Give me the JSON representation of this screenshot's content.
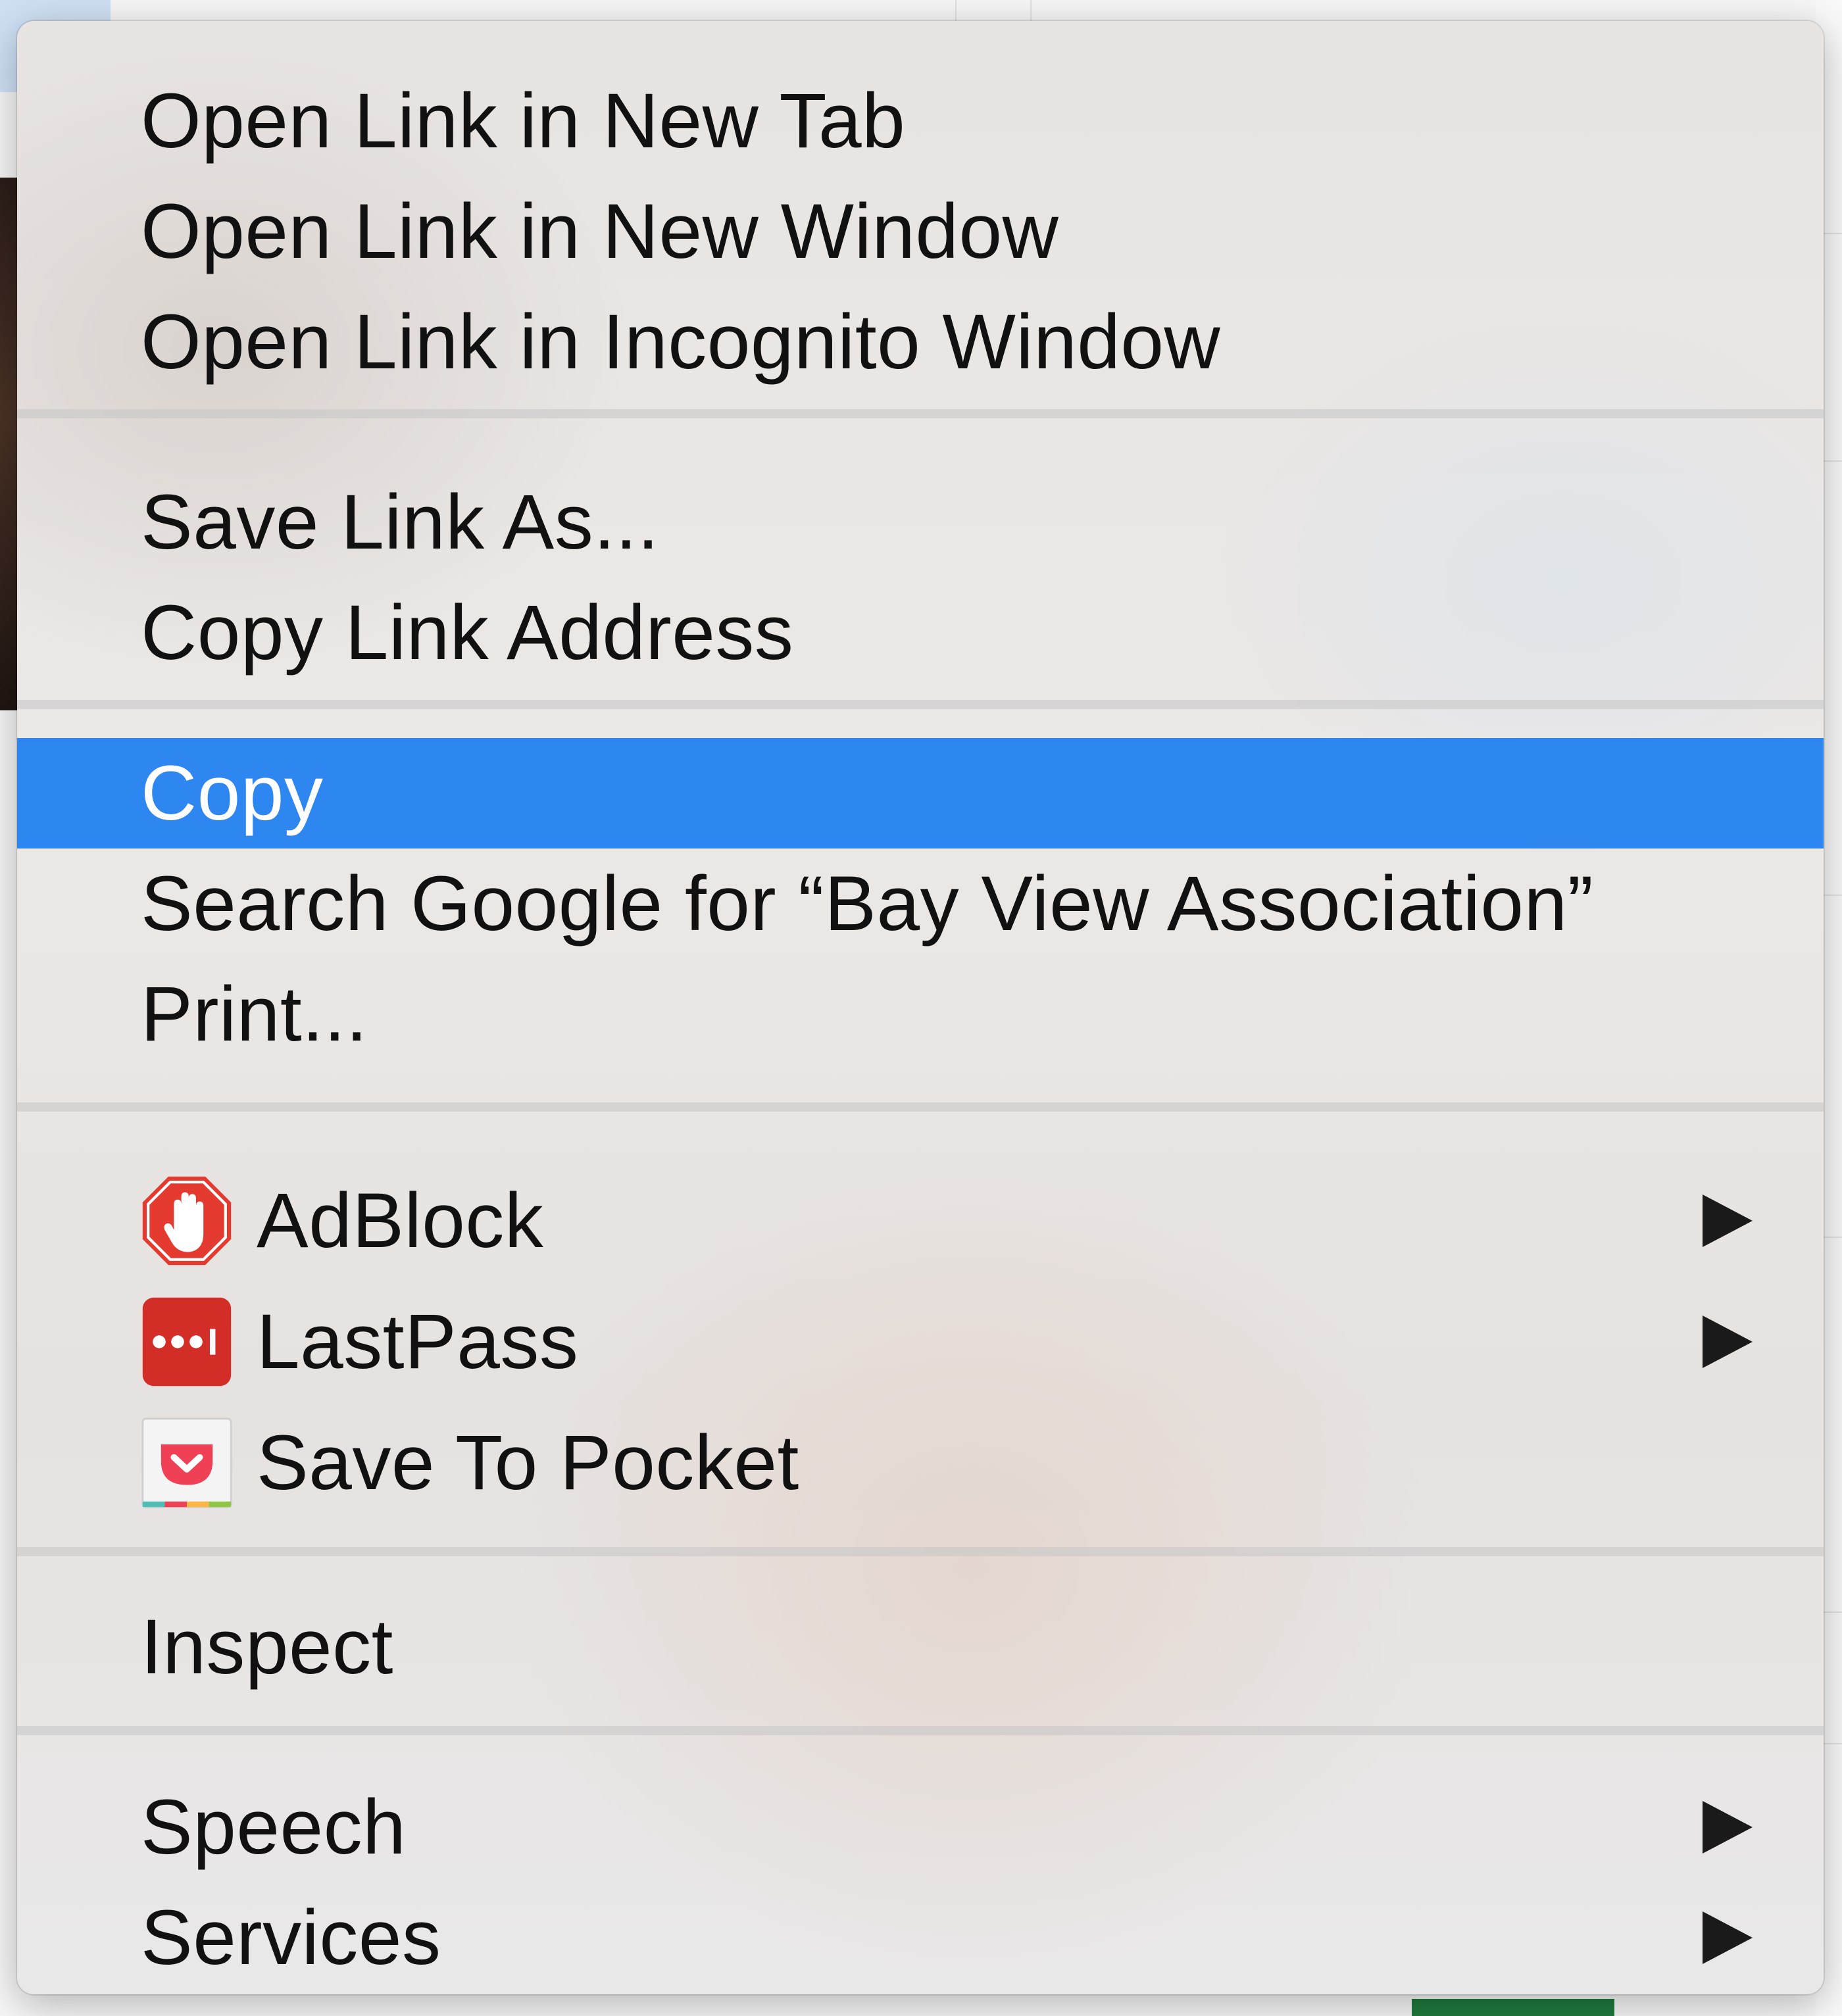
{
  "context_menu": {
    "group_open": {
      "new_tab": "Open Link in New Tab",
      "new_window": "Open Link in New Window",
      "incognito": "Open Link in Incognito Window"
    },
    "group_link": {
      "save_link_as": "Save Link As...",
      "copy_link_address": "Copy Link Address"
    },
    "group_edit": {
      "copy": "Copy",
      "search_google": "Search Google for “Bay View Association”",
      "print": "Print..."
    },
    "group_extensions": {
      "adblock": "AdBlock",
      "lastpass": "LastPass",
      "save_to_pocket": "Save To Pocket"
    },
    "group_dev": {
      "inspect": "Inspect"
    },
    "group_system": {
      "speech": "Speech",
      "services": "Services"
    },
    "highlighted_item": "Copy",
    "icons": {
      "adblock": "adblock-hand-icon",
      "lastpass": "lastpass-dots-icon",
      "pocket": "pocket-icon",
      "submenu": "submenu-arrow-icon"
    },
    "colors": {
      "highlight": "#2e86f0",
      "adblock_red": "#e53a2f",
      "lastpass_red": "#d32d27",
      "pocket_red": "#ef4056"
    }
  }
}
